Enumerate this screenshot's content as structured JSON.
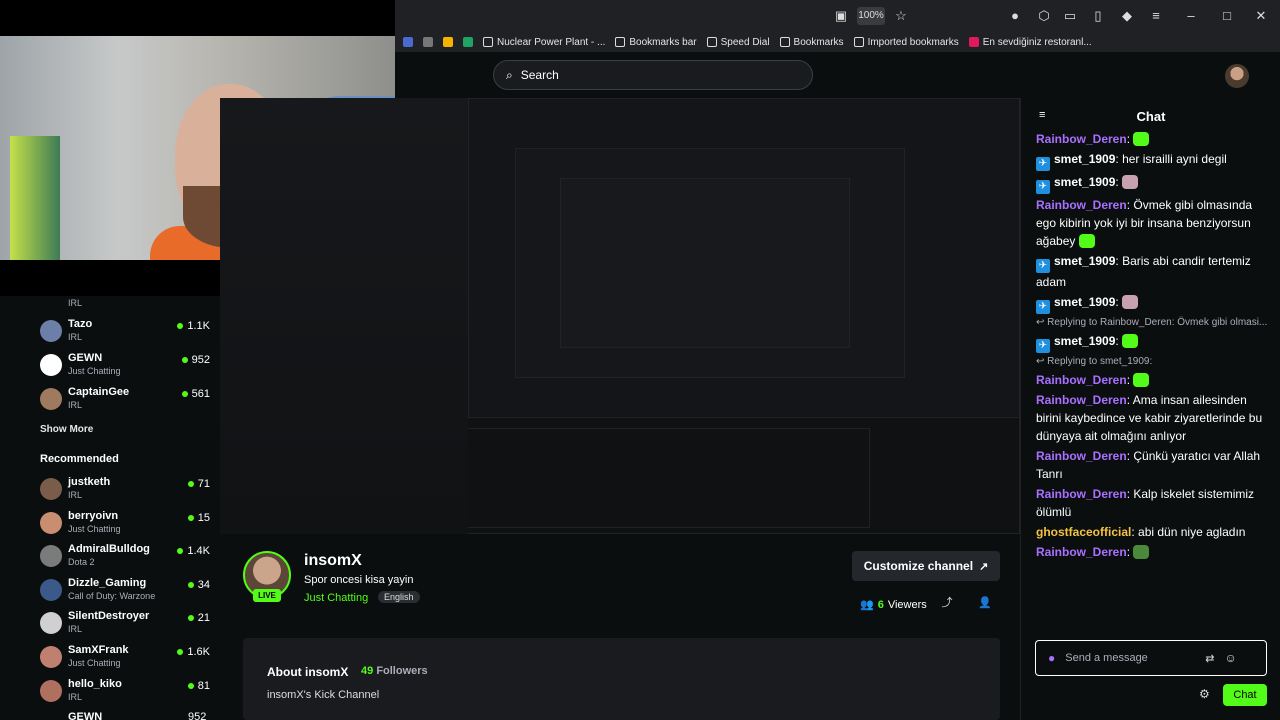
{
  "browser": {
    "zoom": "100%",
    "bookmarks": [
      "Nuclear Power Plant - ...",
      "Bookmarks bar",
      "Speed Dial",
      "Bookmarks",
      "Imported bookmarks",
      "En sevdiğiniz restoranl..."
    ]
  },
  "header": {
    "search_placeholder": "Search"
  },
  "sidebar": {
    "partial_top_game": "IRL",
    "channels": [
      {
        "name": "Tazo",
        "game": "IRL",
        "viewers": "1.1K",
        "color": "#6b7fa8"
      },
      {
        "name": "GEWN",
        "game": "Just Chatting",
        "viewers": "952",
        "color": "#ffffff"
      },
      {
        "name": "CaptainGee",
        "game": "IRL",
        "viewers": "561",
        "color": "#a07a5e"
      }
    ],
    "show_more": "Show More",
    "recommended_title": "Recommended",
    "recommended": [
      {
        "name": "justketh",
        "game": "IRL",
        "viewers": "71",
        "color": "#7a5c4a"
      },
      {
        "name": "berryoivn",
        "game": "Just Chatting",
        "viewers": "15",
        "color": "#c98e72"
      },
      {
        "name": "AdmiralBulldog",
        "game": "Dota 2",
        "viewers": "1.4K",
        "color": "#7b7b7b"
      },
      {
        "name": "Dizzle_Gaming",
        "game": "Call of Duty: Warzone",
        "viewers": "34",
        "color": "#3b5a8a"
      },
      {
        "name": "SilentDestroyer",
        "game": "IRL",
        "viewers": "21",
        "color": "#d0d0d0"
      },
      {
        "name": "SamXFrank",
        "game": "Just Chatting",
        "viewers": "1.6K",
        "color": "#c08070"
      },
      {
        "name": "hello_kiko",
        "game": "IRL",
        "viewers": "81",
        "color": "#b07060"
      }
    ],
    "partial_bottom_name": "GEWN",
    "partial_bottom_viewers": "952"
  },
  "channel": {
    "name": "insomX",
    "live_label": "LIVE",
    "stream_title": "Spor oncesi kisa yayin",
    "category": "Just Chatting",
    "language": "English",
    "customize_label": "Customize channel",
    "viewers_count": "6",
    "viewers_label": "Viewers",
    "about_title": "About insomX",
    "followers_count": "49",
    "followers_label": "Followers",
    "about_desc": "insomX's Kick Channel"
  },
  "chat": {
    "title": "Chat",
    "messages": [
      {
        "user": "Rainbow_Deren",
        "color": "#a970ff",
        "text": "",
        "emote": "#53fc18",
        "badge": false
      },
      {
        "user": "smet_1909",
        "color": "#ffffff",
        "text": "her israilli ayni degil",
        "badge": true
      },
      {
        "user": "smet_1909",
        "color": "#ffffff",
        "text": "",
        "emote": "#c9a0b0",
        "badge": true
      },
      {
        "user": "Rainbow_Deren",
        "color": "#a970ff",
        "text": "Övmek gibi olmasında ego kibirin yok iyi bir insana benziyorsun ağabey",
        "emote": "#53fc18",
        "badge": false
      },
      {
        "user": "smet_1909",
        "color": "#ffffff",
        "text": "Baris abi candir tertemiz adam",
        "badge": true
      },
      {
        "user": "smet_1909",
        "color": "#ffffff",
        "text": "",
        "emote": "#c9a0b0",
        "badge": true
      },
      {
        "reply": "Replying to Rainbow_Deren: Övmek gibi olmasi..."
      },
      {
        "user": "smet_1909",
        "color": "#ffffff",
        "text": "",
        "emote": "#53fc18",
        "badge": true
      },
      {
        "reply": "Replying to smet_1909:"
      },
      {
        "user": "Rainbow_Deren",
        "color": "#a970ff",
        "text": "",
        "emote": "#53fc18",
        "badge": false
      },
      {
        "user": "Rainbow_Deren",
        "color": "#a970ff",
        "text": "Ama insan ailesinden birini kaybedince ve kabir ziyaretlerinde bu dünyaya ait olmağını anlıyor",
        "badge": false
      },
      {
        "user": "Rainbow_Deren",
        "color": "#a970ff",
        "text": "Çünkü yaratıcı var Allah Tanrı",
        "badge": false
      },
      {
        "user": "Rainbow_Deren",
        "color": "#a970ff",
        "text": "Kalp iskelet sistemimiz ölümlü",
        "badge": false
      },
      {
        "user": "ghostfaceofficial",
        "color": "#f5c242",
        "text": "abi dün niye agladın",
        "badge": false
      },
      {
        "user": "Rainbow_Deren",
        "color": "#a970ff",
        "text": "",
        "emote": "#4a8a3a",
        "badge": false
      }
    ],
    "input_placeholder": "Send a message",
    "send_label": "Chat"
  }
}
